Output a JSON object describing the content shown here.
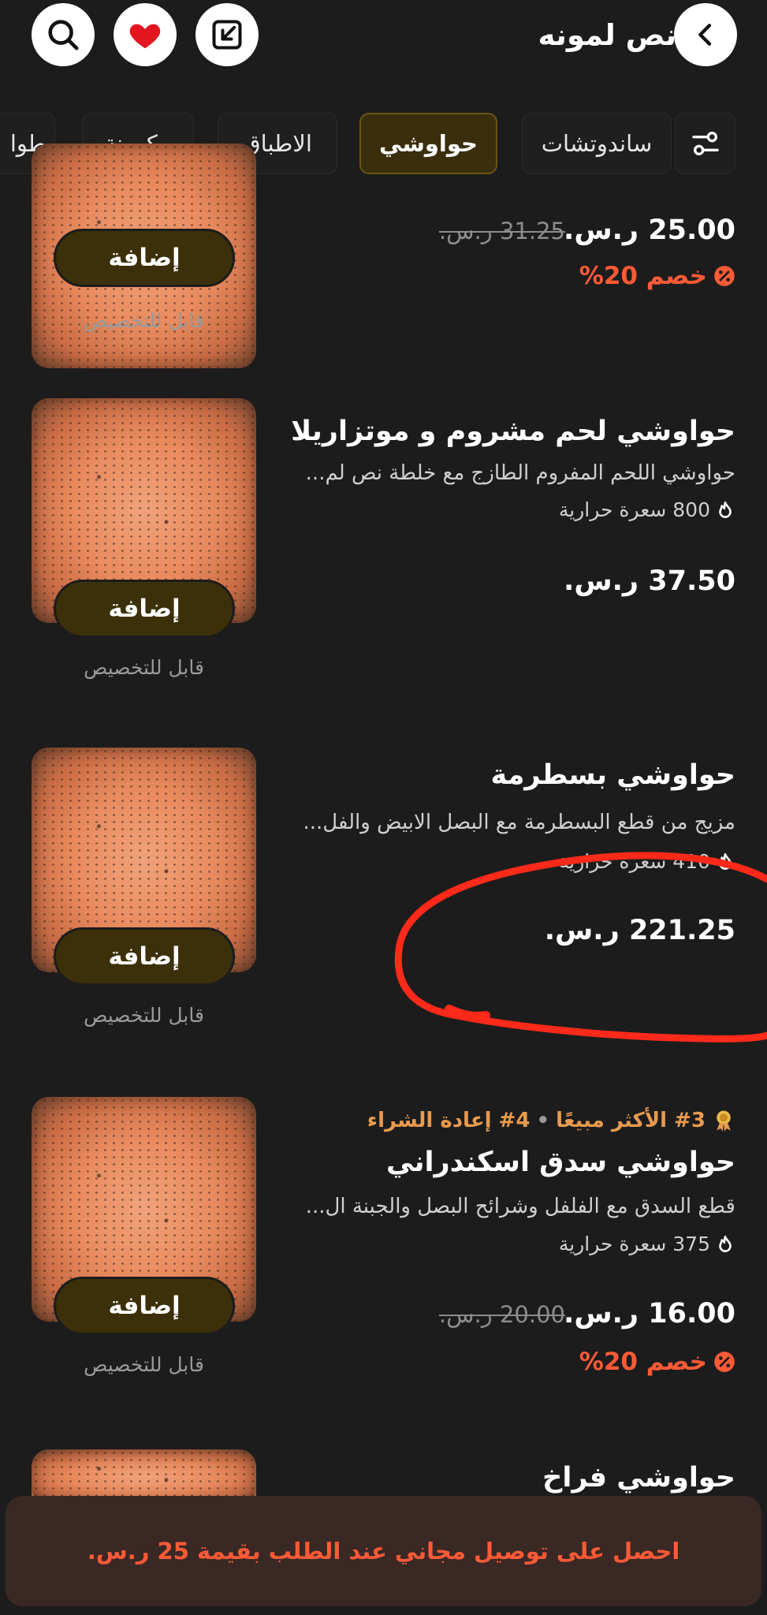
{
  "header": {
    "title": "نص لمونه",
    "icons": [
      "back-icon",
      "external-link-icon",
      "heart-icon",
      "search-icon"
    ]
  },
  "tabs": [
    {
      "label": "ساندوتشات",
      "active": false
    },
    {
      "label": "حواوشي",
      "active": true
    },
    {
      "label": "الاطباق",
      "active": false
    },
    {
      "label": "مكرونة",
      "active": false
    },
    {
      "label": "طوا",
      "active": false
    }
  ],
  "common": {
    "add_label": "إضافة",
    "customizable": "قابل للتخصيص"
  },
  "items": [
    {
      "price": "25.00 ر.س.",
      "old_price": "31.25 ر.س.",
      "discount": "خصم 20%"
    },
    {
      "name": "حواوشي لحم مشروم و موتزاريلا",
      "description": "حواوشي اللحم المفروم  الطازج مع خلطة نص لم...",
      "calories": "800 سعرة حرارية",
      "price": "37.50 ر.س."
    },
    {
      "name": "حواوشي بسطرمة",
      "description": "مزيج من قطع البسطرمة مع البصل الابيض والفل...",
      "calories": "410 سعرة حرارية",
      "price": "221.25 ر.س."
    },
    {
      "badge_best": "#3 الأكثر مبيعًا",
      "badge_reorder": "#4 إعادة الشراء",
      "name": "حواوشي سدق اسكندراني",
      "description": "قطع السدق مع الفلفل وشرائح البصل والجبنة ال...",
      "calories": "375 سعرة حرارية",
      "price": "16.00 ر.س.",
      "old_price": "20.00 ر.س.",
      "discount": "خصم 20%"
    },
    {
      "name": "حواوشي فراخ"
    }
  ],
  "banner": {
    "text": "احصل على توصيل مجاني عند الطلب بقيمة 25 ر.س."
  },
  "colors": {
    "background": "#1c1c1c",
    "accent_active_tab": "#3a2e0d",
    "add_button": "#3c300a",
    "discount": "#ff5a36",
    "badge": "#e89a4e",
    "annotation": "#ff2a1a"
  }
}
